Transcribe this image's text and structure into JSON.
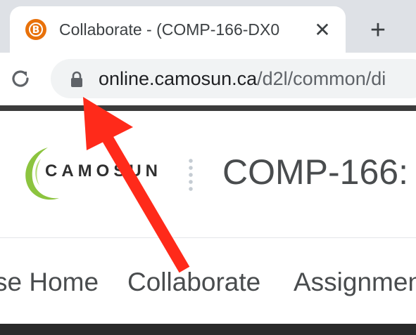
{
  "browser": {
    "tab": {
      "title": "Collaborate - (COMP-166-DX0",
      "favicon_icon": "brightspace-b-icon",
      "favicon_letter": "B",
      "close_label": "✕"
    },
    "new_tab_label": "+",
    "address_bar": {
      "domain": "online.camosun.ca",
      "path": "/d2l/common/di"
    }
  },
  "site": {
    "logo_text": "CAMOSUN",
    "course_title": "COMP-166:"
  },
  "nav": {
    "items": [
      {
        "label": "se Home"
      },
      {
        "label": "Collaborate"
      },
      {
        "label": "Assignmen"
      }
    ]
  },
  "colors": {
    "annotation_arrow": "#ff2a1a",
    "logo_green": "#8cc43f",
    "favicon": "#e8710a"
  }
}
